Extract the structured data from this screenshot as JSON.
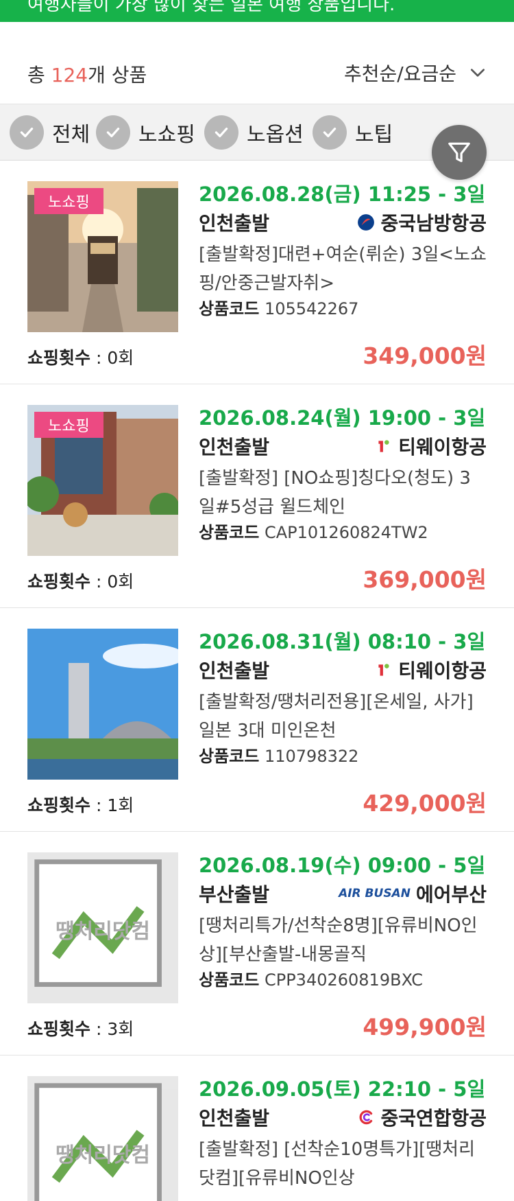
{
  "banner": {
    "text": "여행자들이 가장 많이 찾는 일본 여행 상품입니다."
  },
  "summary": {
    "prefix": "총 ",
    "count": "124",
    "suffix": "개 상품",
    "sort_label": "추천순/요금순"
  },
  "filters": [
    "전체",
    "노쇼핑",
    "노옵션",
    "노팁"
  ],
  "labels": {
    "shopping_count": "쇼핑횟수",
    "product_code": "상품코드",
    "no_shopping_badge": "노쇼핑",
    "placeholder_logo": "땡처리닷컴"
  },
  "products": [
    {
      "date": "2026.08.28(금) 11:25 - 3일",
      "departure": "인천출발",
      "airline": "중국남방항공",
      "airline_icon": "china-southern-logo-icon",
      "title": "[출발확정]대련+여순(뤼순) 3일<노쇼핑/안중근발자취>",
      "code": "105542267",
      "shopping": ": 0회",
      "price": "349,000원",
      "badge": true
    },
    {
      "date": "2026.08.24(월) 19:00 - 3일",
      "departure": "인천출발",
      "airline": "티웨이항공",
      "airline_icon": "tway-logo-icon",
      "title": "[출발확정] [NO쇼핑]칭다오(청도) 3일#5성급 윌드체인",
      "code": "CAP101260824TW2",
      "shopping": ": 0회",
      "price": "369,000원",
      "badge": true
    },
    {
      "date": "2026.08.31(월) 08:10 - 3일",
      "departure": "인천출발",
      "airline": "티웨이항공",
      "airline_icon": "tway-logo-icon",
      "title": "[출발확정/땡처리전용][온세일, 사가] 일본 3대 미인온천",
      "code": "110798322",
      "shopping": ": 1회",
      "price": "429,000원",
      "badge": false
    },
    {
      "date": "2026.08.19(수) 09:00 - 5일",
      "departure": "부산출발",
      "airline": "에어부산",
      "airline_icon": "air-busan-logo-icon",
      "airline_logo_text": "AIR BUSAN",
      "title": "[땡처리특가/선착순8명][유류비NO인상][부산출발-내몽골직",
      "code": "CPP340260819BXC",
      "shopping": ": 3회",
      "price": "499,900원",
      "badge": false
    },
    {
      "date": "2026.09.05(토) 22:10 - 5일",
      "departure": "인천출발",
      "airline": "중국연합항공",
      "airline_icon": "china-united-logo-icon",
      "title": "[출발확정] [선착순10명특가][땡처리닷컴][유류비NO인상",
      "code": "",
      "shopping": "",
      "price": "",
      "badge": false
    }
  ],
  "colors": {
    "brand_green": "#17b24a",
    "price_red": "#e8625a",
    "badge_pink": "#ec4a82"
  }
}
